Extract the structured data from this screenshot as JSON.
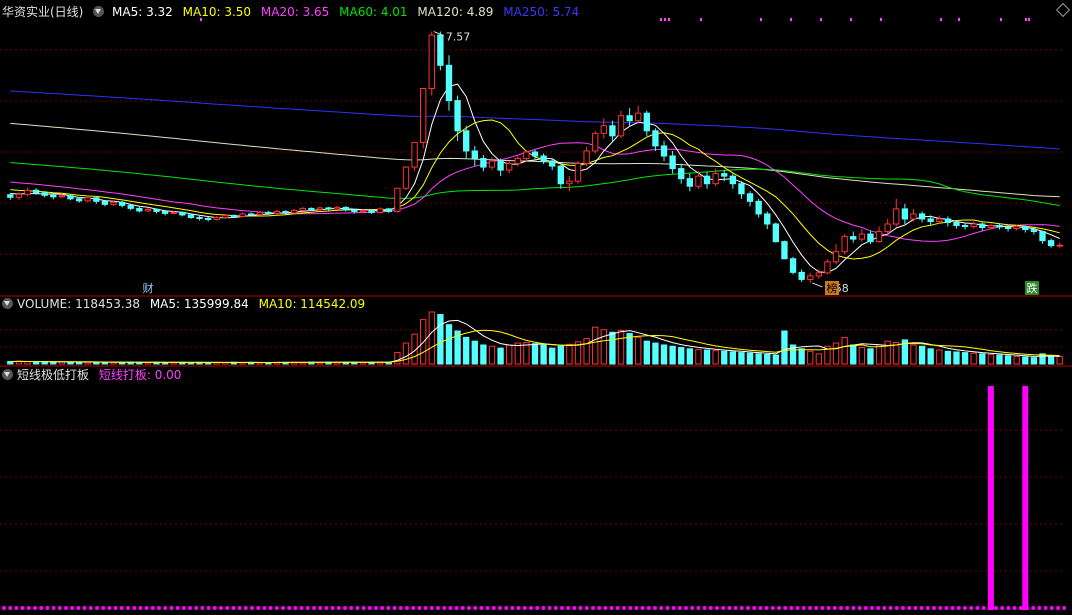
{
  "header": {
    "stock": "华资实业(日线)",
    "ma5": "MA5: 3.32",
    "ma10": "MA10: 3.50",
    "ma20": "MA20: 3.65",
    "ma60": "MA60: 4.01",
    "ma120": "MA120: 4.89",
    "ma250": "MA250: 5.74",
    "high_label": "7.57",
    "low_label": "2.58",
    "badges": [
      "财",
      "榜",
      "跌"
    ]
  },
  "volume_header": {
    "volume": "VOLUME: 118453.38",
    "ma5": "MA5: 135999.84",
    "ma10": "MA10: 114542.09"
  },
  "indicator_header": {
    "name": "短线极低打板",
    "series": "短线打板: 0.00"
  },
  "colors": {
    "up": "#ff3232",
    "down": "#54ffff",
    "ma5": "#ffffff",
    "ma10": "#ffff00",
    "ma20": "#ff40ff",
    "ma60": "#00e600",
    "ma120": "#e0e0c0",
    "ma250": "#3030ff",
    "grid": "#7a0000",
    "signal": "#ff00ff"
  },
  "chart_data": {
    "type": "candlestick",
    "price_range": [
      2.4,
      7.8
    ],
    "highest": 7.57,
    "lowest": 2.58,
    "signal_days": [
      114,
      118
    ],
    "candles": [
      [
        4.33,
        4.28,
        4.36,
        4.23
      ],
      [
        4.28,
        4.34,
        4.38,
        4.23
      ],
      [
        4.34,
        4.42,
        4.47,
        4.3
      ],
      [
        4.42,
        4.37,
        4.46,
        4.33
      ],
      [
        4.37,
        4.32,
        4.4,
        4.28
      ],
      [
        4.32,
        4.29,
        4.36,
        4.24
      ],
      [
        4.29,
        4.31,
        4.36,
        4.26
      ],
      [
        4.31,
        4.25,
        4.34,
        4.22
      ],
      [
        4.25,
        4.21,
        4.28,
        4.17
      ],
      [
        4.21,
        4.27,
        4.31,
        4.18
      ],
      [
        4.27,
        4.2,
        4.3,
        4.15
      ],
      [
        4.2,
        4.14,
        4.23,
        4.1
      ],
      [
        4.14,
        4.18,
        4.22,
        4.11
      ],
      [
        4.18,
        4.12,
        4.21,
        4.08
      ],
      [
        4.12,
        4.06,
        4.15,
        4.02
      ],
      [
        4.06,
        4.01,
        4.09,
        3.98
      ],
      [
        4.01,
        4.04,
        4.07,
        3.99
      ],
      [
        4.04,
        4.0,
        4.06,
        3.96
      ],
      [
        4.0,
        3.96,
        4.03,
        3.92
      ],
      [
        3.96,
        3.98,
        4.01,
        3.94
      ],
      [
        3.98,
        3.93,
        4.0,
        3.9
      ],
      [
        3.93,
        3.88,
        3.96,
        3.85
      ],
      [
        3.88,
        3.86,
        3.91,
        3.82
      ],
      [
        3.86,
        3.84,
        3.89,
        3.8
      ],
      [
        3.84,
        3.88,
        3.91,
        3.82
      ],
      [
        3.88,
        3.92,
        3.95,
        3.86
      ],
      [
        3.92,
        3.9,
        3.94,
        3.87
      ],
      [
        3.9,
        3.95,
        3.98,
        3.88
      ],
      [
        3.95,
        3.94,
        3.98,
        3.91
      ],
      [
        3.94,
        3.98,
        4.01,
        3.92
      ],
      [
        3.98,
        3.96,
        4.01,
        3.93
      ],
      [
        3.96,
        4.0,
        4.03,
        3.94
      ],
      [
        4.0,
        3.97,
        4.02,
        3.94
      ],
      [
        3.97,
        4.02,
        4.05,
        3.95
      ],
      [
        4.02,
        4.06,
        4.09,
        4.0
      ],
      [
        4.06,
        4.04,
        4.08,
        4.01
      ],
      [
        4.04,
        4.07,
        4.1,
        4.02
      ],
      [
        4.07,
        4.05,
        4.09,
        4.02
      ],
      [
        4.05,
        4.08,
        4.11,
        4.03
      ],
      [
        4.08,
        4.03,
        4.1,
        4.0
      ],
      [
        4.03,
        4.0,
        4.05,
        3.96
      ],
      [
        4.0,
        4.02,
        4.05,
        3.97
      ],
      [
        4.02,
        3.98,
        4.04,
        3.95
      ],
      [
        3.98,
        4.05,
        4.08,
        3.96
      ],
      [
        4.05,
        4.0,
        4.07,
        3.97
      ],
      [
        4.0,
        4.46,
        4.46,
        3.98
      ],
      [
        4.46,
        4.88,
        4.9,
        4.42
      ],
      [
        4.88,
        5.37,
        5.37,
        4.8
      ],
      [
        5.37,
        6.44,
        6.44,
        5.25
      ],
      [
        6.44,
        7.5,
        7.57,
        6.3
      ],
      [
        7.5,
        6.9,
        7.57,
        6.8
      ],
      [
        6.9,
        6.2,
        7.1,
        6.0
      ],
      [
        6.2,
        5.6,
        6.3,
        5.4
      ],
      [
        5.6,
        5.2,
        5.7,
        5.05
      ],
      [
        5.2,
        5.05,
        5.3,
        4.9
      ],
      [
        5.05,
        4.88,
        5.12,
        4.8
      ],
      [
        4.88,
        5.0,
        5.08,
        4.82
      ],
      [
        5.0,
        4.82,
        5.05,
        4.7
      ],
      [
        4.82,
        4.95,
        5.0,
        4.76
      ],
      [
        4.95,
        5.05,
        5.1,
        4.9
      ],
      [
        5.05,
        5.18,
        5.22,
        4.98
      ],
      [
        5.18,
        5.1,
        5.22,
        5.02
      ],
      [
        5.1,
        5.0,
        5.15,
        4.94
      ],
      [
        5.0,
        4.9,
        5.05,
        4.82
      ],
      [
        4.9,
        4.55,
        4.92,
        4.45
      ],
      [
        4.55,
        4.6,
        4.7,
        4.4
      ],
      [
        4.6,
        4.95,
        5.0,
        4.55
      ],
      [
        4.95,
        5.2,
        5.28,
        4.9
      ],
      [
        5.2,
        5.55,
        5.6,
        5.15
      ],
      [
        5.55,
        5.7,
        5.85,
        5.45
      ],
      [
        5.7,
        5.5,
        5.8,
        5.4
      ],
      [
        5.5,
        5.9,
        6.0,
        5.45
      ],
      [
        5.9,
        5.8,
        6.05,
        5.7
      ],
      [
        5.8,
        5.95,
        6.1,
        5.75
      ],
      [
        5.95,
        5.6,
        6.0,
        5.5
      ],
      [
        5.6,
        5.3,
        5.65,
        5.2
      ],
      [
        5.3,
        5.1,
        5.4,
        5.0
      ],
      [
        5.1,
        4.85,
        5.2,
        4.75
      ],
      [
        4.85,
        4.65,
        4.95,
        4.55
      ],
      [
        4.65,
        4.5,
        4.75,
        4.4
      ],
      [
        4.5,
        4.7,
        4.8,
        4.45
      ],
      [
        4.7,
        4.55,
        4.78,
        4.45
      ],
      [
        4.55,
        4.75,
        4.85,
        4.5
      ],
      [
        4.75,
        4.7,
        4.82,
        4.6
      ],
      [
        4.7,
        4.55,
        4.75,
        4.45
      ],
      [
        4.55,
        4.35,
        4.6,
        4.25
      ],
      [
        4.35,
        4.2,
        4.4,
        4.1
      ],
      [
        4.2,
        3.95,
        4.25,
        3.88
      ],
      [
        3.95,
        3.75,
        4.0,
        3.65
      ],
      [
        3.75,
        3.4,
        3.78,
        3.38
      ],
      [
        3.4,
        3.06,
        3.42,
        3.06
      ],
      [
        3.06,
        2.79,
        3.1,
        2.75
      ],
      [
        2.79,
        2.65,
        2.85,
        2.6
      ],
      [
        2.65,
        2.72,
        2.78,
        2.58
      ],
      [
        2.72,
        2.78,
        2.85,
        2.66
      ],
      [
        2.78,
        3.0,
        3.05,
        2.75
      ],
      [
        3.0,
        3.2,
        3.35,
        2.95
      ],
      [
        3.2,
        3.5,
        3.55,
        3.15
      ],
      [
        3.5,
        3.45,
        3.6,
        3.38
      ],
      [
        3.45,
        3.55,
        3.65,
        3.4
      ],
      [
        3.55,
        3.4,
        3.62,
        3.35
      ],
      [
        3.4,
        3.6,
        3.7,
        3.38
      ],
      [
        3.6,
        3.75,
        3.85,
        3.55
      ],
      [
        3.75,
        4.05,
        4.25,
        3.7
      ],
      [
        4.05,
        3.85,
        4.15,
        3.75
      ],
      [
        3.85,
        3.95,
        4.05,
        3.8
      ],
      [
        3.95,
        3.85,
        4.0,
        3.78
      ],
      [
        3.85,
        3.8,
        3.92,
        3.72
      ],
      [
        3.8,
        3.85,
        3.92,
        3.75
      ],
      [
        3.85,
        3.78,
        3.9,
        3.7
      ],
      [
        3.78,
        3.72,
        3.82,
        3.66
      ],
      [
        3.72,
        3.7,
        3.78,
        3.64
      ],
      [
        3.7,
        3.75,
        3.8,
        3.66
      ],
      [
        3.75,
        3.68,
        3.78,
        3.62
      ],
      [
        3.68,
        3.72,
        3.76,
        3.64
      ],
      [
        3.72,
        3.69,
        3.75,
        3.64
      ],
      [
        3.69,
        3.66,
        3.72,
        3.6
      ],
      [
        3.66,
        3.7,
        3.74,
        3.62
      ],
      [
        3.7,
        3.64,
        3.72,
        3.58
      ],
      [
        3.64,
        3.6,
        3.68,
        3.54
      ],
      [
        3.6,
        3.42,
        3.62,
        3.36
      ],
      [
        3.42,
        3.32,
        3.46,
        3.28
      ],
      [
        3.32,
        3.33,
        3.38,
        3.28
      ]
    ],
    "volume_range": [
      0,
      820000
    ],
    "volumes": [
      40000,
      42000,
      38000,
      36000,
      34000,
      33000,
      32000,
      30000,
      31000,
      29000,
      28000,
      30000,
      27000,
      26000,
      28000,
      26000,
      25000,
      27000,
      24000,
      26000,
      25000,
      24000,
      26000,
      23000,
      25000,
      24000,
      26000,
      24000,
      25000,
      23000,
      24000,
      26000,
      25000,
      27000,
      26000,
      28000,
      27000,
      29000,
      28000,
      26000,
      25000,
      27000,
      26000,
      28000,
      27000,
      180000,
      330000,
      470000,
      700000,
      820000,
      780000,
      620000,
      520000,
      420000,
      360000,
      300000,
      280000,
      250000,
      300000,
      330000,
      340000,
      320000,
      300000,
      250000,
      280000,
      310000,
      350000,
      400000,
      580000,
      540000,
      500000,
      530000,
      480000,
      420000,
      360000,
      330000,
      300000,
      280000,
      260000,
      240000,
      230000,
      220000,
      210000,
      200000,
      190000,
      180000,
      170000,
      160000,
      150000,
      140000,
      520000,
      300000,
      240000,
      200000,
      160000,
      280000,
      330000,
      420000,
      300000,
      260000,
      240000,
      300000,
      360000,
      340000,
      380000,
      300000,
      280000,
      240000,
      220000,
      200000,
      190000,
      180000,
      170000,
      160000,
      150000,
      140000,
      130000,
      120000,
      110000,
      100000,
      160000,
      130000,
      118453
    ],
    "series": [
      {
        "name": "MA5",
        "values": []
      },
      {
        "name": "MA10",
        "values": []
      },
      {
        "name": "MA20",
        "values": []
      },
      {
        "name": "MA60",
        "values": []
      },
      {
        "name": "MA120",
        "values": []
      },
      {
        "name": "MA250",
        "values": []
      }
    ]
  }
}
